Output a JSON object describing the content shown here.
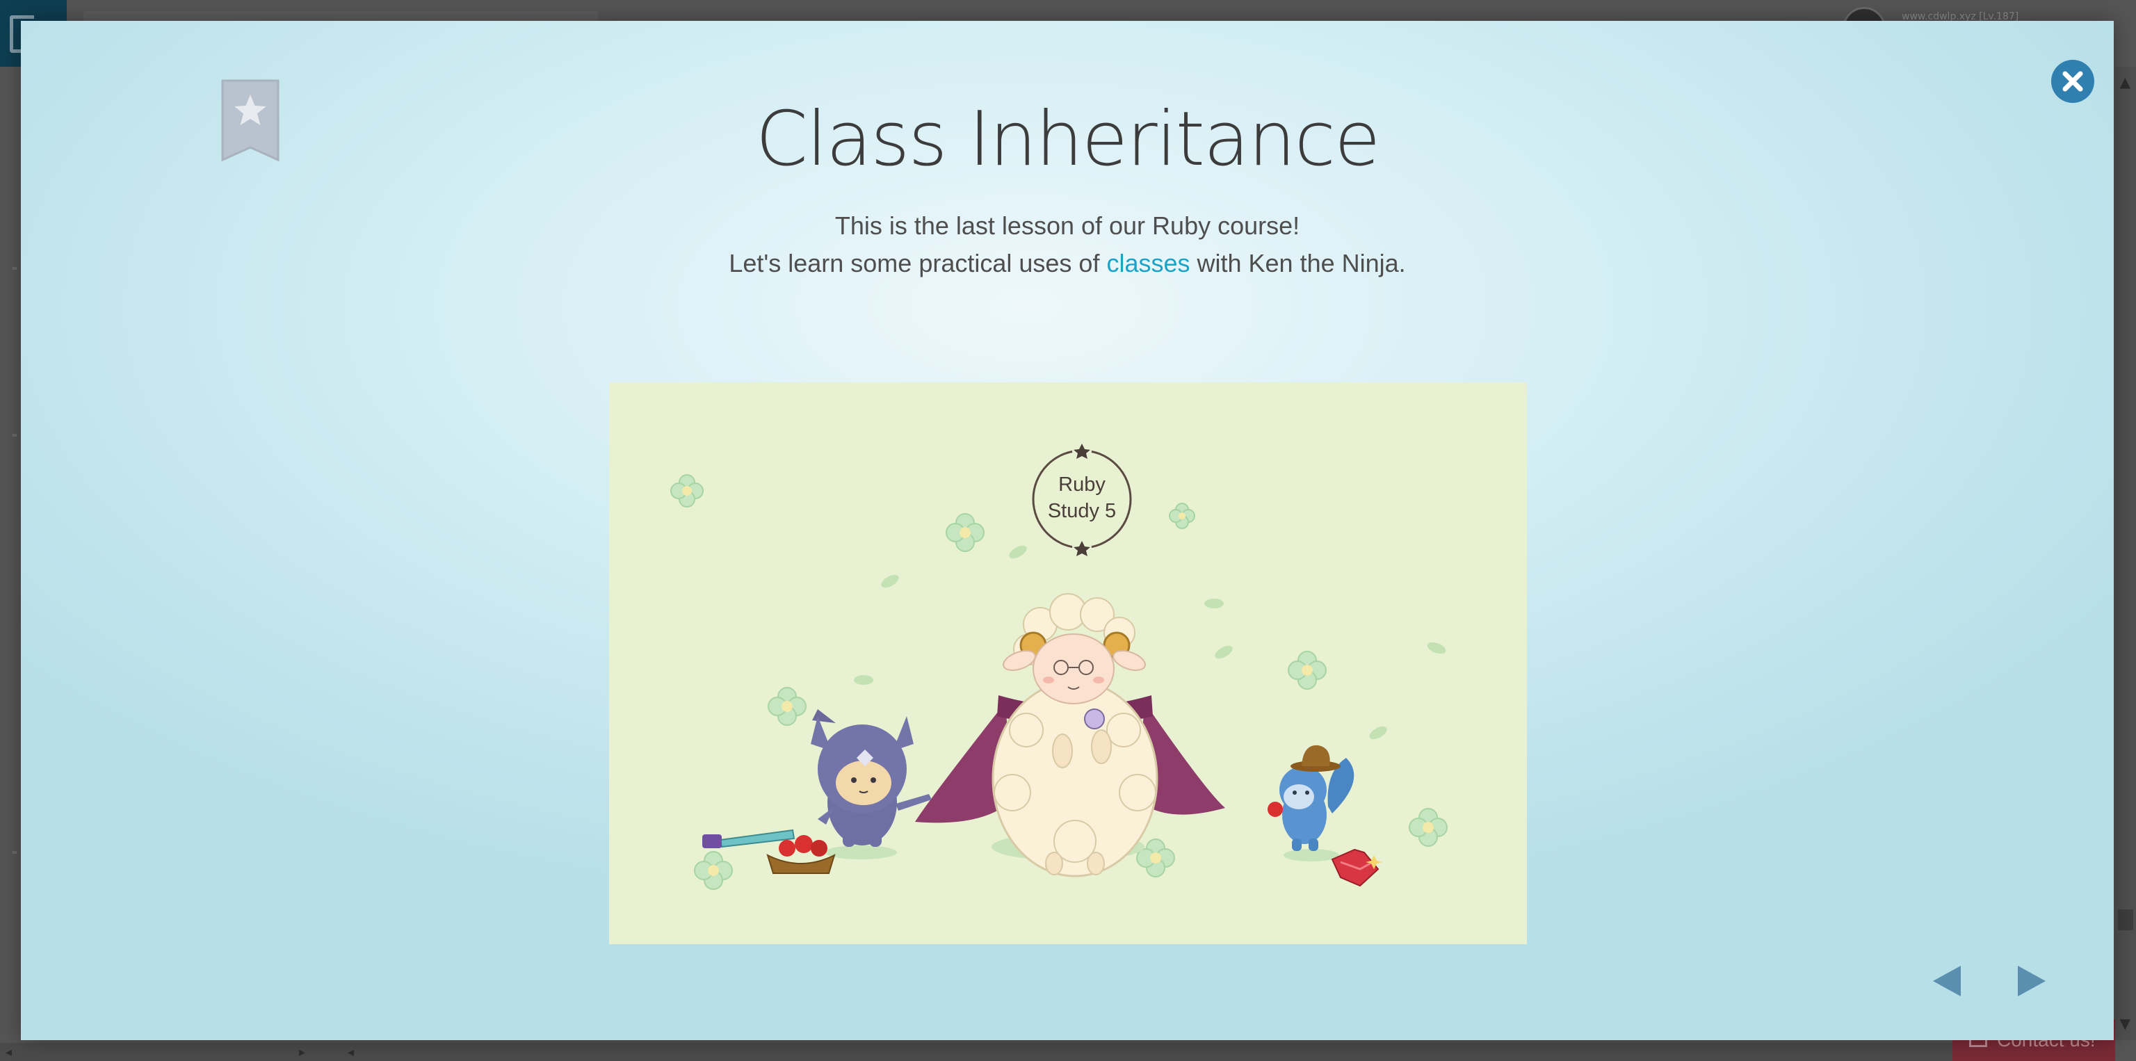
{
  "background": {
    "user_label": "www.cdwlp.xyz [Lv.187]",
    "contact_label": "Contact us!"
  },
  "modal": {
    "title": "Class Inheritance",
    "subtitle_line1": "This is the last lesson of our Ruby course!",
    "subtitle_line2_before": "Let's learn some practical uses of ",
    "subtitle_line2_keyword": "classes",
    "subtitle_line2_after": " with Ken the Ninja.",
    "illustration": {
      "badge_line1": "Ruby",
      "badge_line2": "Study 5"
    },
    "icons": {
      "bookmark": "bookmark-star-icon",
      "close": "close-icon",
      "prev": "prev-arrow-icon",
      "next": "next-arrow-icon"
    },
    "colors": {
      "accent": "#1ba3c6",
      "close_button": "#2f7fb0",
      "arrow": "#5a8fb0"
    }
  }
}
